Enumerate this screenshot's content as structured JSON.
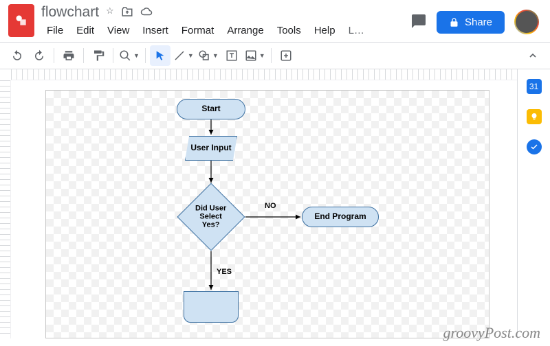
{
  "doc": {
    "title": "flowchart"
  },
  "menu": {
    "file": "File",
    "edit": "Edit",
    "view": "View",
    "insert": "Insert",
    "format": "Format",
    "arrange": "Arrange",
    "tools": "Tools",
    "help": "Help",
    "more": "L…"
  },
  "share": {
    "label": "Share"
  },
  "sidepanel": {
    "cal": "31"
  },
  "flow": {
    "start": "Start",
    "input": "User Input",
    "decision": "Did User\nSelect\nYes?",
    "no": "NO",
    "yes": "YES",
    "end": "End Program"
  },
  "watermark": "groovyPost.com"
}
